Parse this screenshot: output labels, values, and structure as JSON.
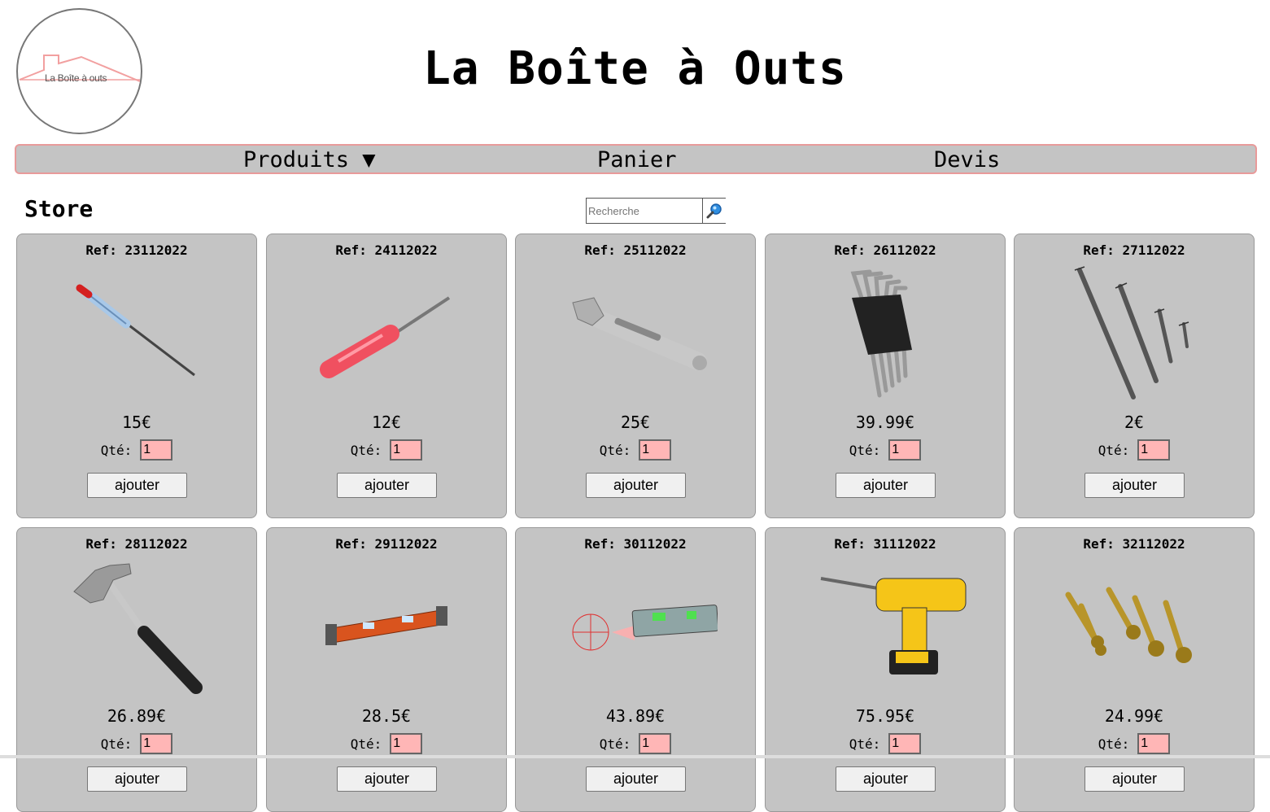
{
  "header": {
    "logo_text": "La Boîte à outs",
    "title": "La Boîte à Outs"
  },
  "nav": {
    "products": "Produits ▼",
    "cart": "Panier",
    "quote": "Devis"
  },
  "store": {
    "title": "Store",
    "search_placeholder": "Recherche",
    "qty_label": "Qté:",
    "add_label": "ajouter"
  },
  "products": [
    {
      "ref": "Ref: 23112022",
      "price": "15€",
      "qty": "1",
      "icon": "tester-screwdriver-icon"
    },
    {
      "ref": "Ref: 24112022",
      "price": "12€",
      "qty": "1",
      "icon": "screwdriver-icon"
    },
    {
      "ref": "Ref: 25112022",
      "price": "25€",
      "qty": "1",
      "icon": "adjustable-wrench-icon"
    },
    {
      "ref": "Ref: 26112022",
      "price": "39.99€",
      "qty": "1",
      "icon": "hex-key-set-icon"
    },
    {
      "ref": "Ref: 27112022",
      "price": "2€",
      "qty": "1",
      "icon": "screws-icon"
    },
    {
      "ref": "Ref: 28112022",
      "price": "26.89€",
      "qty": "1",
      "icon": "hammer-icon"
    },
    {
      "ref": "Ref: 29112022",
      "price": "28.5€",
      "qty": "1",
      "icon": "spirit-level-icon"
    },
    {
      "ref": "Ref: 30112022",
      "price": "43.89€",
      "qty": "1",
      "icon": "laser-level-icon"
    },
    {
      "ref": "Ref: 31112022",
      "price": "75.95€",
      "qty": "1",
      "icon": "cordless-drill-icon"
    },
    {
      "ref": "Ref: 32112022",
      "price": "24.99€",
      "qty": "1",
      "icon": "forstner-bits-icon"
    }
  ]
}
